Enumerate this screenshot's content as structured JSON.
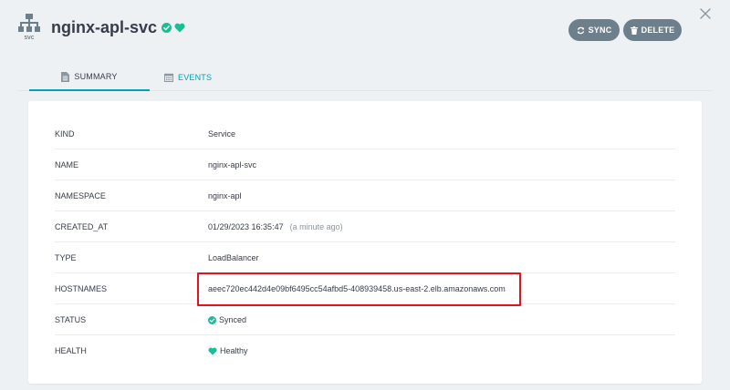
{
  "header": {
    "kind_icon": "network-tree-icon",
    "kind_label": "svc",
    "title": "nginx-apl-svc",
    "sync_label": "SYNC",
    "delete_label": "DELETE"
  },
  "colors": {
    "accent": "#00a2b3",
    "healthy": "#18be94",
    "button": "#6d7f8b",
    "highlight": "#e0141c"
  },
  "tabs": [
    {
      "label": "SUMMARY",
      "icon": "document-icon",
      "active": true
    },
    {
      "label": "EVENTS",
      "icon": "calendar-icon",
      "active": false
    }
  ],
  "summary": [
    {
      "key": "KIND",
      "value": "Service"
    },
    {
      "key": "NAME",
      "value": "nginx-apl-svc"
    },
    {
      "key": "NAMESPACE",
      "value": "nginx-apl"
    },
    {
      "key": "CREATED_AT",
      "value": "01/29/2023 16:35:47",
      "extra": "(a minute ago)"
    },
    {
      "key": "TYPE",
      "value": "LoadBalancer"
    },
    {
      "key": "HOSTNAMES",
      "value": "aeec720ec442d4e09bf6495cc54afbd5-408939458.us-east-2.elb.amazonaws.com"
    },
    {
      "key": "STATUS",
      "value": "Synced",
      "icon": "check-circle-icon"
    },
    {
      "key": "HEALTH",
      "value": "Healthy",
      "icon": "heart-icon"
    }
  ]
}
